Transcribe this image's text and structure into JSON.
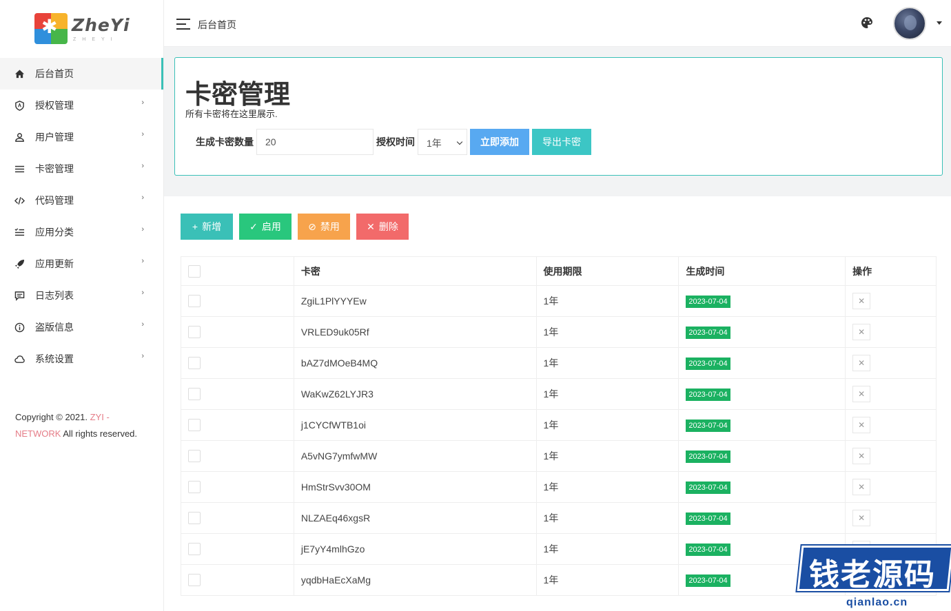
{
  "brand": {
    "name": "ZheYi",
    "sub": "ZHEYI"
  },
  "sidebar": {
    "items": [
      {
        "label": "后台首页",
        "icon": "home-icon"
      },
      {
        "label": "授权管理",
        "icon": "shield-icon"
      },
      {
        "label": "用户管理",
        "icon": "user-icon"
      },
      {
        "label": "卡密管理",
        "icon": "menu-lines-icon"
      },
      {
        "label": "代码管理",
        "icon": "code-icon"
      },
      {
        "label": "应用分类",
        "icon": "list-icon"
      },
      {
        "label": "应用更新",
        "icon": "rocket-icon"
      },
      {
        "label": "日志列表",
        "icon": "message-icon"
      },
      {
        "label": "盗版信息",
        "icon": "info-icon"
      },
      {
        "label": "系统设置",
        "icon": "cloud-icon"
      }
    ],
    "copyright_prefix": "Copyright © 2021.",
    "copyright_brand": "ZYI - NETWORK",
    "copyright_suffix": "All rights reserved."
  },
  "topbar": {
    "title": "后台首页"
  },
  "header": {
    "title": "卡密管理",
    "desc": "所有卡密将在这里展示.",
    "count_label": "生成卡密数量",
    "count_value": "20",
    "time_label": "授权时间",
    "time_value": "1年",
    "add_button": "立即添加",
    "export_button": "导出卡密"
  },
  "toolbar": {
    "new_label": "新增",
    "enable_label": "启用",
    "disable_label": "禁用",
    "delete_label": "删除"
  },
  "table": {
    "columns": [
      "卡密",
      "使用期限",
      "生成时间",
      "操作"
    ],
    "rows": [
      {
        "key": "ZgiL1PlYYYEw",
        "period": "1年",
        "date": "2023-07-04"
      },
      {
        "key": "VRLED9uk05Rf",
        "period": "1年",
        "date": "2023-07-04"
      },
      {
        "key": "bAZ7dMOeB4MQ",
        "period": "1年",
        "date": "2023-07-04"
      },
      {
        "key": "WaKwZ62LYJR3",
        "period": "1年",
        "date": "2023-07-04"
      },
      {
        "key": "j1CYCfWTB1oi",
        "period": "1年",
        "date": "2023-07-04"
      },
      {
        "key": "A5vNG7ymfwMW",
        "period": "1年",
        "date": "2023-07-04"
      },
      {
        "key": "HmStrSvv30OM",
        "period": "1年",
        "date": "2023-07-04"
      },
      {
        "key": "NLZAEq46xgsR",
        "period": "1年",
        "date": "2023-07-04"
      },
      {
        "key": "jE7yY4mlhGzo",
        "period": "1年",
        "date": "2023-07-04"
      },
      {
        "key": "yqdbHaEcXaMg",
        "period": "1年",
        "date": "2023-07-04"
      }
    ]
  },
  "watermark": {
    "text": "钱老源码",
    "url": "qianlao.cn"
  }
}
